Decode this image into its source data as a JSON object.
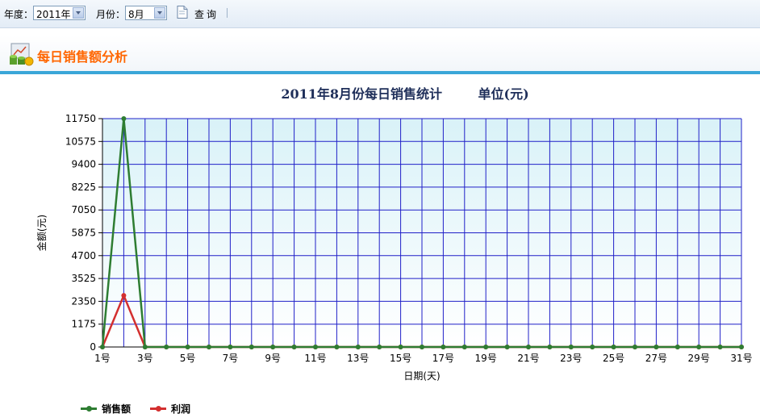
{
  "toolbar": {
    "year_label": "年度：",
    "year_value": "2011年",
    "month_label": "月份：",
    "month_value": "8月",
    "query_label": "查询",
    "icons": {
      "query": "document-search-icon",
      "dropdown": "chevron-down-icon"
    }
  },
  "section": {
    "title": "每日销售额分析",
    "icon": "sales-chart-icon",
    "title_color": "#ff6600",
    "bar_color": "#3aa6d8"
  },
  "chart_data": {
    "type": "line",
    "title": "2011年8月份每日销售统计        单位(元)",
    "xlabel": "日期(天)",
    "ylabel": "金额(元)",
    "ylim": [
      0,
      11750
    ],
    "yticks": [
      0,
      1175,
      2350,
      3525,
      4700,
      5875,
      7050,
      8225,
      9400,
      10575,
      11750
    ],
    "x": [
      1,
      2,
      3,
      4,
      5,
      6,
      7,
      8,
      9,
      10,
      11,
      12,
      13,
      14,
      15,
      16,
      17,
      18,
      19,
      20,
      21,
      22,
      23,
      24,
      25,
      26,
      27,
      28,
      29,
      30,
      31
    ],
    "xtick_labels": [
      "1号",
      "3号",
      "5号",
      "7号",
      "9号",
      "11号",
      "13号",
      "15号",
      "17号",
      "19号",
      "21号",
      "23号",
      "25号",
      "27号",
      "29号",
      "31号"
    ],
    "grid": true,
    "legend_position": "bottom-left",
    "series": [
      {
        "name": "销售额",
        "color": "#2e7d32",
        "values": [
          0,
          11750,
          0,
          0,
          0,
          0,
          0,
          0,
          0,
          0,
          0,
          0,
          0,
          0,
          0,
          0,
          0,
          0,
          0,
          0,
          0,
          0,
          0,
          0,
          0,
          0,
          0,
          0,
          0,
          0,
          0
        ]
      },
      {
        "name": "利润",
        "color": "#d32f2f",
        "values": [
          0,
          2650,
          0,
          0,
          0,
          0,
          0,
          0,
          0,
          0,
          0,
          0,
          0,
          0,
          0,
          0,
          0,
          0,
          0,
          0,
          0,
          0,
          0,
          0,
          0,
          0,
          0,
          0,
          0,
          0,
          0
        ]
      }
    ]
  }
}
